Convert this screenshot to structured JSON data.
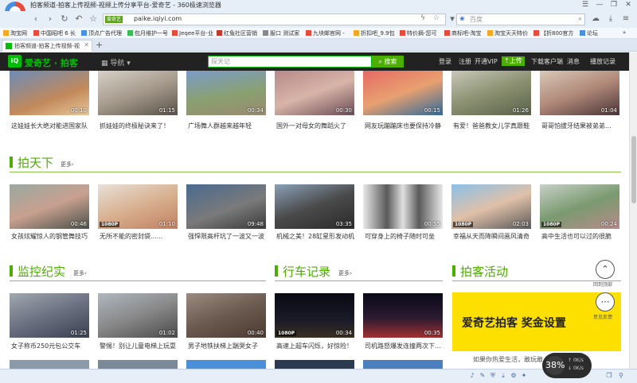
{
  "window": {
    "title": "拍客频道-拍客上传视频-视频上传分享平台-爱奇艺 - 360极速浏览器",
    "controls": [
      "☰",
      "—",
      "❐",
      "✕"
    ]
  },
  "address": {
    "badge": "爱奇艺",
    "url": "paike.iqiyi.com",
    "search_placeholder": "百度"
  },
  "bookmarks": [
    "淘宝网",
    "中国昭吧 6 长",
    "顶点广告代理",
    "包月维护一号",
    "Jeqee平台-业",
    "红兔社区营销",
    "服口 测试家",
    "九块邮官网 -",
    "折扣吧_9.9包",
    "特价摘-您可",
    "商标吧-淘宝",
    "淘宝天天特价",
    "【折800官方",
    "论坛"
  ],
  "tab": {
    "title": "拍客频道-拍客上传视频-视",
    "new": "+"
  },
  "site": {
    "logo": "iQIYI",
    "brand": "爱奇艺 · 拍客",
    "nav": "导航",
    "search_placeholder": "探天记",
    "search_btn": "搜索",
    "links": [
      "登录",
      "注册",
      "开通VIP",
      "上传",
      "下载客户端",
      "消息",
      "播放记录"
    ]
  },
  "sections": {
    "top": [
      {
        "dur": "00:10",
        "cap": "这娃娃长大绝对能进国家队"
      },
      {
        "dur": "01:15",
        "cap": "抓娃娃的终极秘诀来了！"
      },
      {
        "dur": "00:34",
        "cap": "广场舞人群越来越年轻"
      },
      {
        "dur": "00:30",
        "cap": "国外一对母女的舞蹈火了"
      },
      {
        "dur": "00:15",
        "cap": "网友玩蹦蹦床也要保持冷静"
      },
      {
        "dur": "01:26",
        "cap": "有爱！爸爸教女儿学真跟鞋"
      },
      {
        "dur": "01:04",
        "cap": "哥哥怕拔牙结果被弟弟..."
      }
    ],
    "paitianxia": {
      "title": "拍天下",
      "more": "更多›",
      "items": [
        {
          "dur": "00:46",
          "hd": "",
          "cap": "女孩炫耀惊人的钢管舞技巧"
        },
        {
          "dur": "01:10",
          "hd": "1080P",
          "cap": "无所不能的密封袋......"
        },
        {
          "dur": "09:48",
          "hd": "",
          "cap": "强悍限高杆坑了一波又一波"
        },
        {
          "dur": "03:35",
          "hd": "",
          "cap": "机械之美！28缸星形发动机"
        },
        {
          "dur": "00:55",
          "hd": "",
          "cap": "可穿身上的椅子随时可坐"
        },
        {
          "dur": "02:03",
          "hd": "1080P",
          "cap": "幸福从天而降瞬间画风清奇"
        },
        {
          "dur": "00:24",
          "hd": "1080P",
          "cap": "高中生活也可以过的很脆"
        }
      ]
    },
    "jiankong": {
      "title": "监控纪实",
      "more": "更多›",
      "items": [
        {
          "dur": "01:25",
          "hd": "",
          "cap": "女子称币250元包公交车"
        },
        {
          "dur": "01:02",
          "hd": "",
          "cap": "警惕！别让儿童电梯上玩耍"
        },
        {
          "dur": "00:40",
          "hd": "",
          "cap": "男子地铁扶梯上踹哭女子"
        }
      ]
    },
    "xingche": {
      "title": "行车记录",
      "more": "更多›",
      "items": [
        {
          "dur": "00:34",
          "hd": "1080P",
          "cap": "高速上超车闪烁，好惊险！"
        },
        {
          "dur": "00:35",
          "hd": "",
          "cap": "司机路怒爆发连撞两次下..."
        }
      ]
    },
    "paike": {
      "title": "拍客活动",
      "promo": "爱奇艺拍客 奖金设置",
      "promo_cap": "如果你热爱生活，敢玩敢..."
    }
  },
  "float": {
    "top_label": "回到顶部",
    "feedback_label": "意见反馈"
  },
  "speed": {
    "pct": "38%",
    "up": "0K/s",
    "down": "0K/s"
  }
}
